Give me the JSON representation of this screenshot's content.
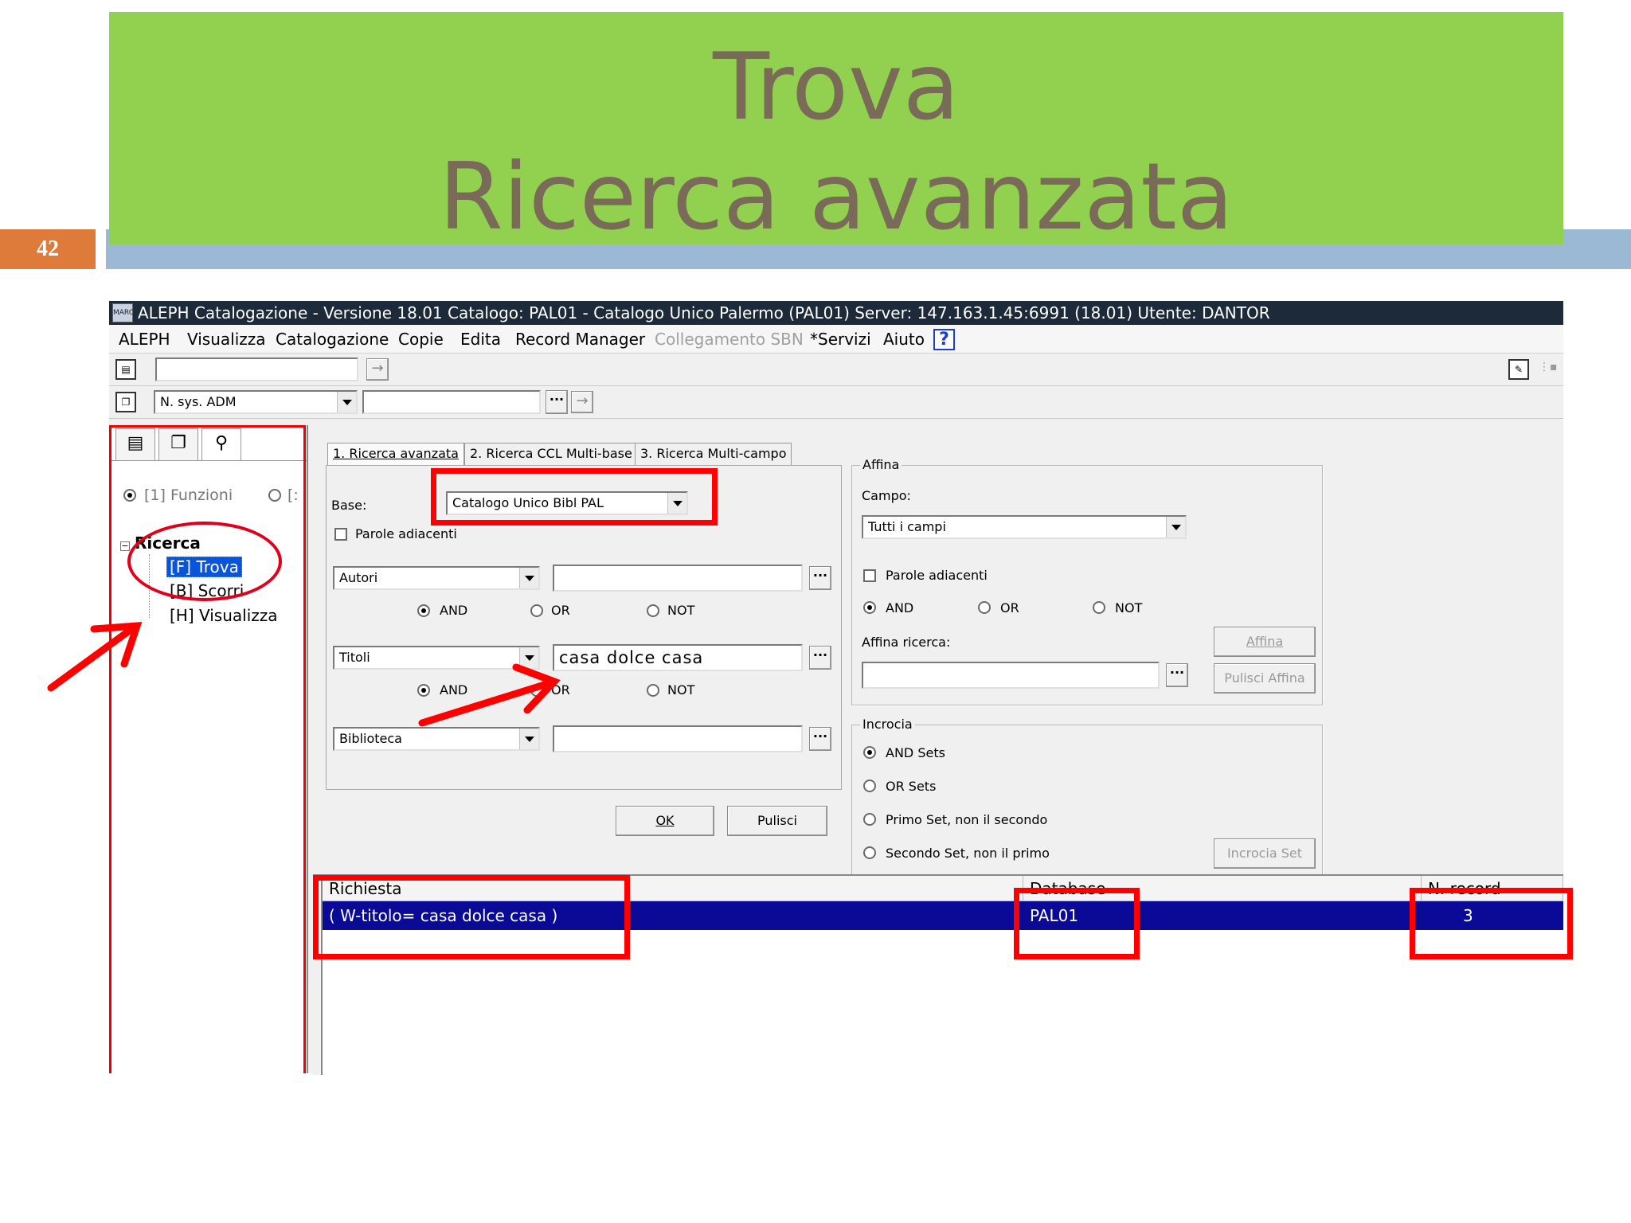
{
  "slide": {
    "title_line1": "Trova",
    "title_line2": "Ricerca avanzata",
    "number": "42"
  },
  "app": {
    "title": "ALEPH Catalogazione - Versione 18.01  Catalogo:  PAL01 - Catalogo Unico Palermo (PAL01)  Server:  147.163.1.45:6991 (18.01)  Utente:  DANTOR",
    "icon_label": "MARC",
    "menu": [
      "ALEPH",
      "Visualizza",
      "Catalogazione",
      "Copie",
      "Edita",
      "Record Manager",
      "Collegamento SBN",
      "*Servizi",
      "Aiuto"
    ],
    "help_label": "?",
    "toolbar2": {
      "combo_value": "N. sys. ADM",
      "dots_label": "···"
    }
  },
  "left_panel": {
    "radio_funzioni": "[1] Funzioni",
    "radio_second": "[:",
    "tree_root": "Ricerca",
    "tree_items": [
      "[F] Trova",
      "[B] Scorri",
      "[H] Visualizza"
    ],
    "tree_toggle": "−"
  },
  "tabs": [
    "1. Ricerca avanzata",
    "2. Ricerca CCL Multi-base",
    "3. Ricerca Multi-campo"
  ],
  "form": {
    "base_label": "Base:",
    "base_value": "Catalogo Unico Bibl PAL",
    "adjacent_label": "Parole adiacenti",
    "fields": [
      {
        "select": "Autori",
        "value": ""
      },
      {
        "select": "Titoli",
        "value": "casa dolce casa"
      },
      {
        "select": "Biblioteca",
        "value": ""
      }
    ],
    "op_and": "AND",
    "op_or": "OR",
    "op_not": "NOT",
    "dots_label": "···",
    "ok_label": "OK",
    "clear_label": "Pulisci"
  },
  "affina": {
    "title": "Affina",
    "campo_label": "Campo:",
    "campo_value": "Tutti i campi",
    "adjacent_label": "Parole adiacenti",
    "op_and": "AND",
    "op_or": "OR",
    "op_not": "NOT",
    "ricerca_label": "Affina ricerca:",
    "affina_button": "Affina",
    "clear_button": "Pulisci Affina",
    "dots_label": "···"
  },
  "incrocia": {
    "title": "Incrocia",
    "options": [
      "AND Sets",
      "OR Sets",
      "Primo Set, non il secondo",
      "Secondo Set, non il primo"
    ],
    "button": "Incrocia Set"
  },
  "results": {
    "headers": [
      "Richiesta",
      "Database",
      "N. record"
    ],
    "rows": [
      {
        "query": "( W-titolo= casa dolce casa )",
        "database": "PAL01",
        "count": "3"
      }
    ]
  },
  "colors": {
    "title_bg": "#92d050",
    "title_text": "#7a6a58",
    "annotation_red": "#ff0000",
    "selection_blue": "#0a0a96"
  }
}
